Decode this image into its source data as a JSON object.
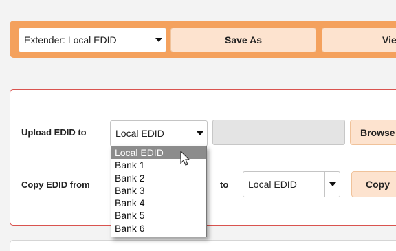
{
  "toolbar": {
    "extender_select_value": "Extender: Local EDID",
    "save_as_label": "Save As",
    "view_label_partial": "Vie"
  },
  "upload": {
    "label": "Upload EDID to",
    "select_value": "Local EDID",
    "browse_label": "Browse"
  },
  "copy": {
    "label": "Copy EDID from",
    "to_label": "to",
    "to_select_value": "Local EDID",
    "copy_label": "Copy"
  },
  "dropdown": {
    "items": [
      "Local EDID",
      "Bank 1",
      "Bank 2",
      "Bank 3",
      "Bank 4",
      "Bank 5",
      "Bank 6"
    ]
  },
  "colors": {
    "accent_orange": "#f4a15d",
    "button_peach": "#fde3cf",
    "panel_border_red": "#d9534f"
  }
}
